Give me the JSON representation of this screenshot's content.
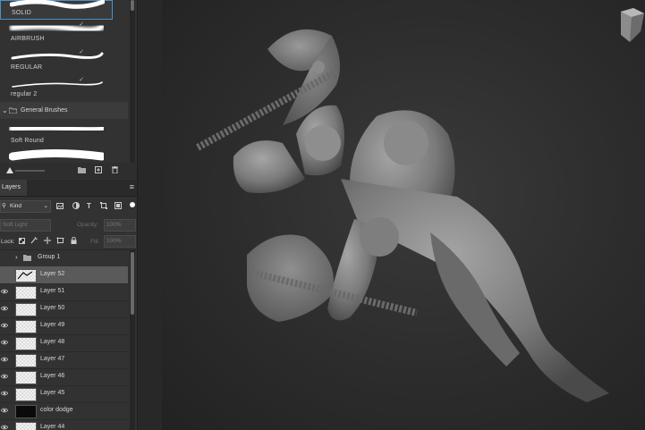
{
  "brushes": {
    "items": [
      {
        "name": "SOLID"
      },
      {
        "name": "AIRBRUSH"
      },
      {
        "name": "REGULAR"
      },
      {
        "name": "regular 2"
      }
    ],
    "group_label": "General Brushes",
    "soft_round": "Soft Round"
  },
  "layers_panel": {
    "tab_label": "Layers",
    "filter_kind": "Kind",
    "blend_mode": "Soft Light",
    "opacity_label": "Opacity:",
    "opacity_value": "100%",
    "lock_label": "Lock:",
    "fill_label": "Fill:",
    "fill_value": "100%",
    "group_name": "Group 1",
    "layers": [
      {
        "name": "Layer 52",
        "selected": true
      },
      {
        "name": "Layer 51"
      },
      {
        "name": "Layer 50"
      },
      {
        "name": "Layer 49"
      },
      {
        "name": "Layer 48"
      },
      {
        "name": "Layer 47"
      },
      {
        "name": "Layer 46"
      },
      {
        "name": "Layer 45"
      },
      {
        "name": "color dodge",
        "dark": true
      },
      {
        "name": "Layer 44"
      }
    ]
  },
  "colors": {
    "panel_bg": "#323232",
    "selected_row": "#5a5a5a",
    "canvas_bg": "#2c2c2c"
  }
}
